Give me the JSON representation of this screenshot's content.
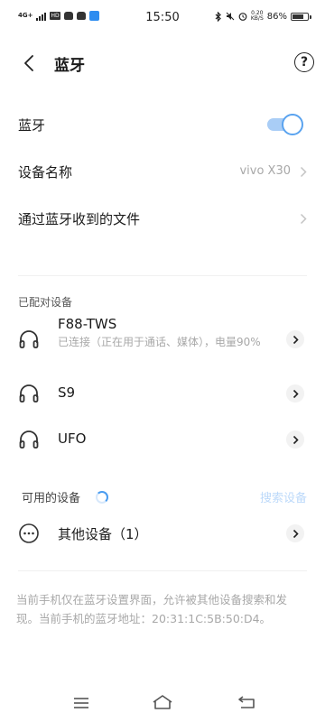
{
  "status_bar": {
    "network": "4G+",
    "hd": "HD",
    "time": "15:50",
    "speed_value": "0.20",
    "speed_unit": "KB/S",
    "battery": "86%",
    "battery_level": 0.86
  },
  "header": {
    "title": "蓝牙",
    "help_symbol": "?"
  },
  "bluetooth": {
    "label": "蓝牙",
    "enabled": true
  },
  "device_name": {
    "label": "设备名称",
    "value": "vivo X30"
  },
  "received_files": {
    "label": "通过蓝牙收到的文件"
  },
  "paired": {
    "section_label": "已配对设备",
    "devices": [
      {
        "name": "F88-TWS",
        "status": "已连接（正在用于通话、媒体），电量90%"
      },
      {
        "name": "S9",
        "status": ""
      },
      {
        "name": "UFO",
        "status": ""
      }
    ]
  },
  "available": {
    "section_label": "可用的设备",
    "search_label": "搜索设备",
    "other_devices": "其他设备（1）"
  },
  "footer_note": "当前手机仅在蓝牙设置界面，允许被其他设备搜索和发现。当前手机的蓝牙地址：20:31:1C:5B:50:D4。",
  "colors": {
    "accent": "#4a9cf0",
    "toggle_track": "#a9cdf6",
    "search_link": "#bcd9fa",
    "secondary_text": "#a8a8a8"
  }
}
